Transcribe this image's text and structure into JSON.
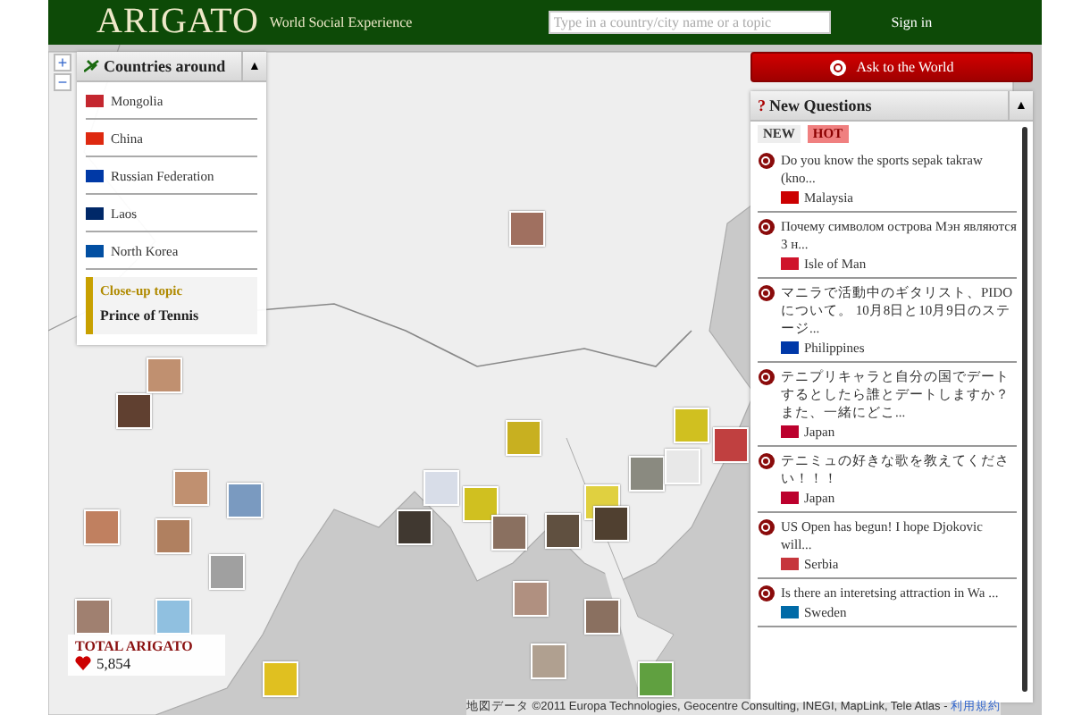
{
  "header": {
    "logo": "ARIGATO",
    "tagline": "World Social Experience",
    "search": {
      "placeholder": "Type in a country/city name or a topic"
    },
    "sign_in": "Sign in"
  },
  "zoom": {
    "plus": "+",
    "minus": "−"
  },
  "countries_panel": {
    "title": "Countries around",
    "toggle": "▲",
    "items": [
      {
        "name": "Mongolia",
        "color": "#c4272f"
      },
      {
        "name": "China",
        "color": "#de2910"
      },
      {
        "name": "Russian Federation",
        "color": "#0039a6"
      },
      {
        "name": "Laos",
        "color": "#002868"
      },
      {
        "name": "North Korea",
        "color": "#024fa2"
      }
    ],
    "close_up": {
      "label": "Close-up topic",
      "title": "Prince of Tennis"
    }
  },
  "ask_button": "Ask to the World",
  "questions_panel": {
    "title": "New Questions",
    "mark": "?",
    "toggle": "▲",
    "tabs": [
      {
        "label": "NEW",
        "selected": false
      },
      {
        "label": "HOT",
        "selected": true
      }
    ],
    "items": [
      {
        "text": "Do you know the sports sepak takraw (kno...",
        "country": "Malaysia",
        "color": "#cc0001"
      },
      {
        "text": "Почему символом острова Мэн являются 3 н...",
        "country": "Isle of Man",
        "color": "#cf142b"
      },
      {
        "text": "マニラで活動中のギタリスト、PIDOについて。 10月8日と10月9日のステージ...",
        "country": "Philippines",
        "color": "#0038a8"
      },
      {
        "text": "テニプリキャラと自分の国でデートするとしたら誰とデートしますか？また、一緒にどこ...",
        "country": "Japan",
        "color": "#bc002d"
      },
      {
        "text": "テニミュの好きな歌を教えてください！！！",
        "country": "Japan",
        "color": "#bc002d"
      },
      {
        "text": "US Open has begun! I hope Djokovic will...",
        "country": "Serbia",
        "color": "#c6363c"
      },
      {
        "text": "Is there an interetsing attraction in Wa ...",
        "country": "Sweden",
        "color": "#006aa7"
      }
    ]
  },
  "total": {
    "label": "TOTAL ARIGATO",
    "count": "5,854"
  },
  "attribution": {
    "text": "地図データ ©2011 Europa Technologies, Geocentre Consulting, INEGI, MapLink, Tele Atlas -",
    "link": "利用規約"
  }
}
